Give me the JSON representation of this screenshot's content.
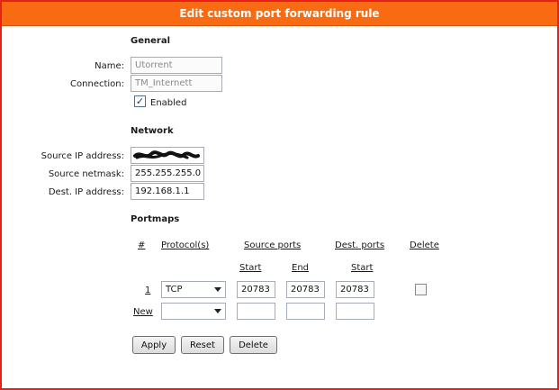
{
  "window": {
    "title": "Edit custom port forwarding rule"
  },
  "general": {
    "heading": "General",
    "name_label": "Name:",
    "name_value": "Utorrent",
    "connection_label": "Connection:",
    "connection_value": "TM_Internett",
    "enabled_label": "Enabled",
    "enabled": true
  },
  "network": {
    "heading": "Network",
    "source_ip_label": "Source IP address:",
    "source_ip_value": "",
    "source_netmask_label": "Source netmask:",
    "source_netmask_value": "255.255.255.0",
    "dest_ip_label": "Dest. IP address:",
    "dest_ip_value": "192.168.1.1"
  },
  "portmaps": {
    "heading": "Portmaps",
    "columns": {
      "index": "#",
      "protocol": "Protocol(s)",
      "source_ports": "Source ports",
      "dest_ports": "Dest. ports",
      "delete": "Delete"
    },
    "sub_columns": {
      "source_start": "Start",
      "source_end": "End",
      "dest_start": "Start"
    },
    "rows": [
      {
        "index": "1",
        "protocol": "TCP",
        "source_start": "20783",
        "source_end": "20783",
        "dest_start": "20783",
        "delete": false
      }
    ],
    "new_row": {
      "index": "New",
      "protocol": "",
      "source_start": "",
      "source_end": "",
      "dest_start": ""
    }
  },
  "buttons": {
    "apply": "Apply",
    "reset": "Reset",
    "delete": "Delete"
  },
  "colors": {
    "header_bg": "#f96b12",
    "border": "#e8201c"
  }
}
